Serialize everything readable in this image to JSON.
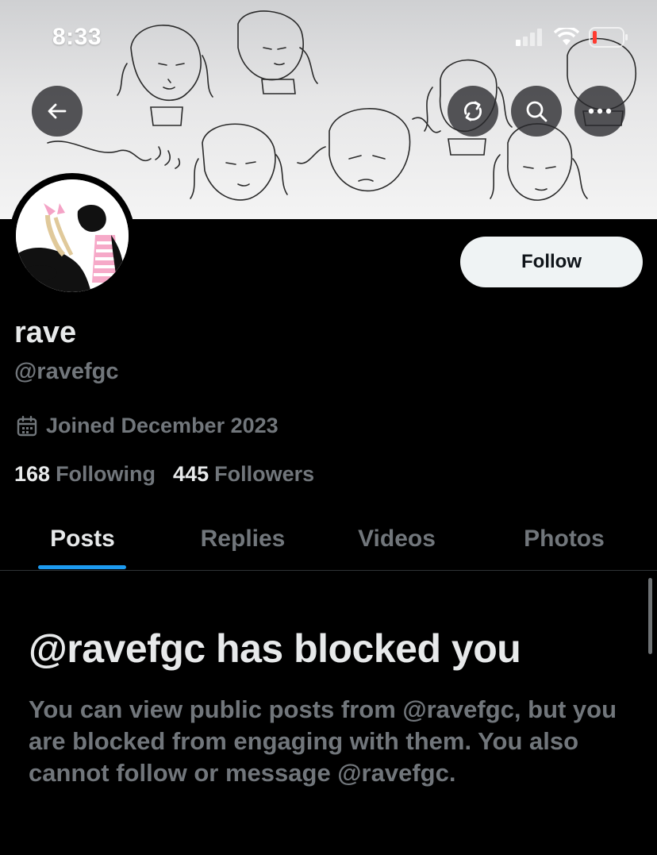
{
  "status_bar": {
    "time": "8:33",
    "icons": [
      "signal-icon",
      "wifi-icon",
      "battery-low-icon"
    ],
    "battery_color": "#ff3b30"
  },
  "header": {
    "banner_description_icon": "sketch-banner",
    "buttons": [
      "back-arrow-icon",
      "sync-icon",
      "search-icon",
      "more-icon"
    ]
  },
  "profile": {
    "name": "rave",
    "handle": "@ravefgc",
    "joined": "Joined December 2023",
    "following_count": "168",
    "following_label": "Following",
    "followers_count": "445",
    "followers_label": "Followers",
    "follow_label": "Follow"
  },
  "tabs": [
    {
      "label": "Posts",
      "active": true
    },
    {
      "label": "Replies",
      "active": false
    },
    {
      "label": "Videos",
      "active": false
    },
    {
      "label": "Photos",
      "active": false
    }
  ],
  "blocked": {
    "title": "@ravefgc has blocked you",
    "description": "You can view public posts from @ravefgc, but you are blocked from engaging with them. You also cannot follow or message @ravefgc."
  },
  "colors": {
    "background": "#000000",
    "primary_text": "#e7e9ea",
    "secondary_text": "#71767b",
    "accent": "#1d9bf0",
    "follow_button_bg": "#eff3f4"
  }
}
